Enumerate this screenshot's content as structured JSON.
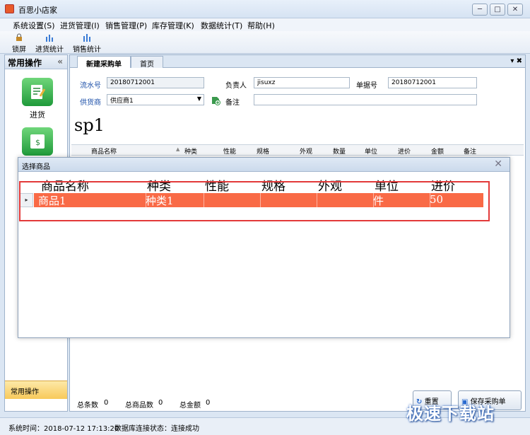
{
  "window": {
    "title": "百思小店家",
    "min": "─",
    "max": "□",
    "close": "✕"
  },
  "menu": [
    "系统设置(S)",
    "进货管理(I)",
    "销售管理(P)",
    "库存管理(K)",
    "数据统计(T)",
    "帮助(H)"
  ],
  "toolbar": {
    "lock": "锁屏",
    "purchase_stats": "进货统计",
    "sales_stats": "销售统计"
  },
  "sidebar": {
    "title": "常用操作",
    "collapse": "«",
    "item1": "进货",
    "bottom": "常用操作"
  },
  "tabs": {
    "active": "新建采购单",
    "home": "首页",
    "pin": "▾ ✖"
  },
  "form": {
    "serial_label": "流水号",
    "serial_value": "20180712001",
    "owner_label": "负责人",
    "owner_value": "jisuxz",
    "doc_label": "单据号",
    "doc_value": "20180712001",
    "supplier_label": "供货商",
    "supplier_value": "供应商1",
    "note_label": "备注",
    "note_value": ""
  },
  "search_text": "sp1",
  "grid_headers": [
    "商品名称",
    "种类",
    "性能",
    "规格",
    "外观",
    "数量",
    "单位",
    "进价",
    "金额",
    "备注"
  ],
  "totals": {
    "count_label": "总条数",
    "count": "0",
    "items_label": "总商品数",
    "items": "0",
    "amount_label": "总金额",
    "amount": "0"
  },
  "buttons": {
    "reset": "重置",
    "save": "保存采购单"
  },
  "dialog": {
    "title": "选择商品",
    "close": "✕",
    "headers": [
      "商品名称",
      "种类",
      "性能",
      "规格",
      "外观",
      "单位",
      "进价"
    ],
    "row": [
      "商品1",
      "种类1",
      "",
      "",
      "",
      "件",
      "50"
    ],
    "indicator": "▸"
  },
  "status": {
    "time": "系统时间：2018-07-12 17:13:20",
    "db": "数据库连接状态：连接成功"
  },
  "watermark": "极速下载站"
}
